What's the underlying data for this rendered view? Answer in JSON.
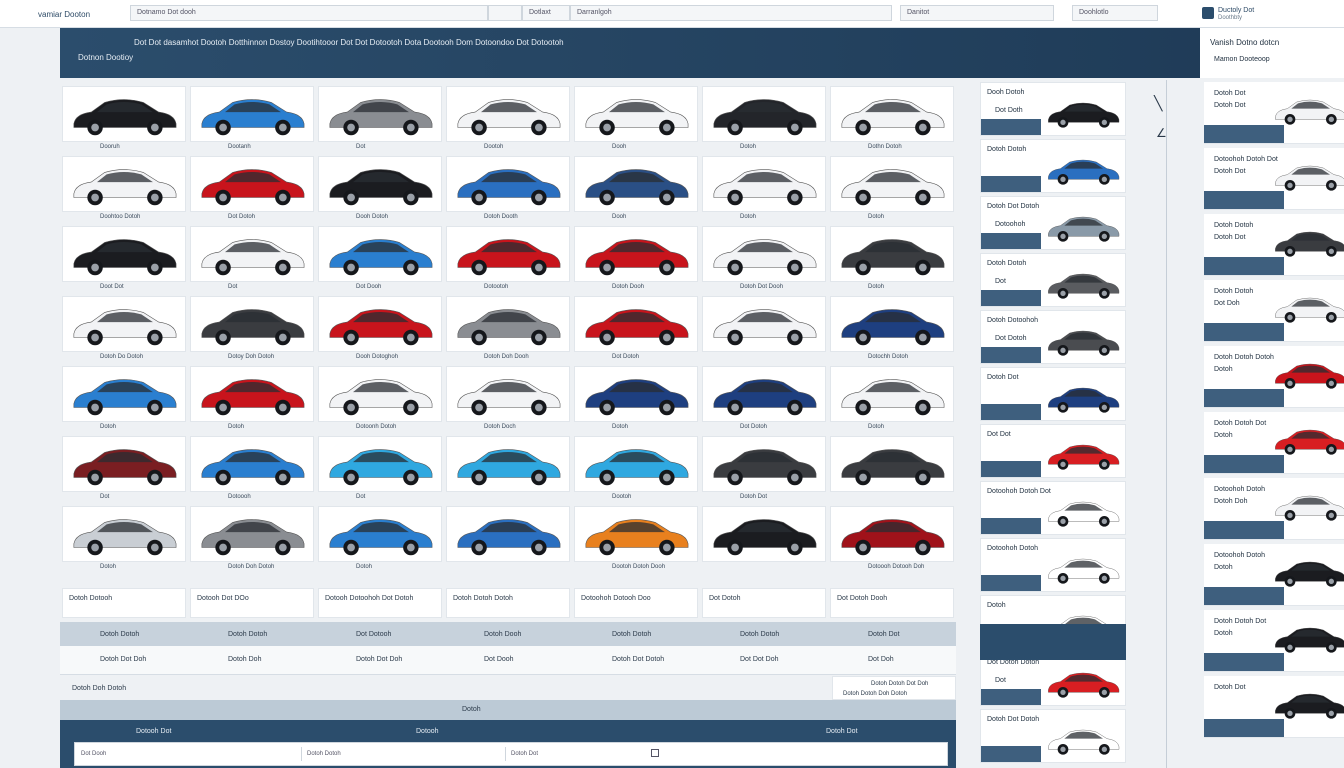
{
  "topbar": {
    "brand": "vamiar Dooton",
    "search_placeholder": "Dotnamo Dot dooh",
    "filter1": "Dotlaxt",
    "filter2": "Darranlgoh",
    "filter3": "Danitot",
    "filter4": "Doohlotlo",
    "account_label": "Ductoly Dot",
    "account_sub": "Doothbty"
  },
  "banner": {
    "headline": "Dot Dot dasamhot Dootoh Dotthinnon Dostoy Dootihtooor Dot Dot Dotootoh Dota Dootooh Dom Dotoondoo Dot Dotootoh",
    "subline": "Dotnon Dootioy",
    "right_title": "Vanish Dotno dotcn",
    "right_sub": "Mamon Dooteoop"
  },
  "grid": {
    "rows": [
      {
        "captions": [
          "Dooruh",
          "Dootanh",
          "Dot",
          "Dootoh",
          "Dooh",
          "Dotoh",
          "Dothn Dotoh"
        ],
        "colors": [
          "#1b1c20",
          "#2a7fd0",
          "#8a8d92",
          "#f2f3f5",
          "#f2f3f5",
          "#23252a",
          "#f2f3f5"
        ]
      },
      {
        "captions": [
          "Doohtoo Dotoh",
          "Dot Dotoh",
          "Dooh Dotoh",
          "Dotoh Dooth",
          "Dooh",
          "Dotoh",
          "Dotoh"
        ],
        "colors": [
          "#f2f3f5",
          "#c8141c",
          "#1b1c20",
          "#2a6fc0",
          "#2a4f85",
          "#f2f3f5",
          "#f2f3f5"
        ]
      },
      {
        "captions": [
          "Doot Dot",
          "Dot",
          "Dot Dooh",
          "Dotootoh",
          "Dotoh Dooh",
          "Dotoh Dot Dooh",
          "Dotoh"
        ],
        "colors": [
          "#1b1c20",
          "#f2f3f5",
          "#2a7fd0",
          "#c8141c",
          "#c8141c",
          "#f2f3f5",
          "#3a3c40"
        ]
      },
      {
        "captions": [
          "Dotoh Do Dotoh",
          "Dotoy Doh Dotoh",
          "Dooh Dotoghoh",
          "Dotoh Doh Dooh",
          "Dot Dotoh",
          "",
          "Dotochh Dotoh"
        ],
        "colors": [
          "#f2f3f5",
          "#3a3c40",
          "#c8141c",
          "#8a8d92",
          "#c8141c",
          "#f2f3f5",
          "#1e3f80"
        ]
      },
      {
        "captions": [
          "Dotoh",
          "Dotoh",
          "Dotoonh Dotoh",
          "Dotoh Doch",
          "Dotoh",
          "Dot Dotoh",
          "Dotoh"
        ],
        "colors": [
          "#2a7fd0",
          "#c8141c",
          "#f2f3f5",
          "#f2f3f5",
          "#1e3f80",
          "#1e3f80",
          "#f2f3f5"
        ]
      },
      {
        "captions": [
          "Dot",
          "Dotoooh",
          "Dot",
          "",
          "Dootoh",
          "Dotoh Dot",
          ""
        ],
        "colors": [
          "#7a1e22",
          "#2a7fd0",
          "#2fa8e0",
          "#2fa8e0",
          "#2fa8e0",
          "#3a3c40",
          "#3a3c40"
        ]
      },
      {
        "captions": [
          "Dotoh",
          "Dotoh Doh Dotoh",
          "Dotoh",
          "",
          "Dootoh Dotoh Dooh",
          "",
          "Dotoooh Dotooh Doh"
        ],
        "colors": [
          "#c9ced4",
          "#8a8d92",
          "#2a7fd0",
          "#2a6fc0",
          "#e8801e",
          "#1b1c20",
          "#a0121a"
        ]
      }
    ]
  },
  "bottom_row": [
    "Dotoh Dotooh",
    "Dotooh Dot DOo",
    "Dotooh Dotoohoh Dot Dotoh",
    "Dotoh Dotoh Dotoh",
    "Dotoohoh Dotooh Doo",
    "Dot Dotoh",
    "Dot Dotoh Dooh"
  ],
  "table": {
    "headers": [
      "Dotoh Dotoh",
      "Dotoh Dotoh",
      "Dot Dotooh",
      "Dotoh Dooh",
      "Dotoh Dotoh",
      "Dotoh Dotoh",
      "Dotoh Dot"
    ],
    "values": [
      "Dotoh Dot Doh",
      "Dotoh Doh",
      "Dotoh Dot Doh",
      "Dot Dooh",
      "Dotoh Dot Dotoh",
      "Dot Dot Doh",
      "Dot Doh"
    ],
    "note_left": "Dotoh Doh Dotoh",
    "note_right": "Dotoh Dotoh Dot Doh",
    "note_right2": "Dotoh Dotoh Doh Dotoh"
  },
  "footer": {
    "bar_label": "Dotoh",
    "dark_labels": [
      "Dotooh Dot",
      "Dotooh",
      "Dotoh Dot"
    ],
    "input_segments": [
      "Dot Dooh",
      "Dotoh Dotoh",
      "Dotoh Dot"
    ]
  },
  "side1": {
    "cards": [
      {
        "title": "Dooh Dotoh",
        "sub": "Dot Doth",
        "color": "#1b1c20"
      },
      {
        "title": "Dotoh Dotoh",
        "sub": "",
        "color": "#2a6fc0"
      },
      {
        "title": "Dotoh Dot Dotoh",
        "sub": "Dotoohoh",
        "color": "#8a9aa8"
      },
      {
        "title": "Dotoh Dotoh",
        "sub": "Dot",
        "color": "#5a5c60"
      },
      {
        "title": "Dotoh Dotoohoh",
        "sub": "Dot Dotoh",
        "color": "#4a4c50"
      },
      {
        "title": "Dotoh Dot",
        "sub": "",
        "color": "#1e3f80"
      },
      {
        "title": "Dot Dot",
        "sub": "",
        "color": "#d81e22"
      },
      {
        "title": "Dotoohoh Dotoh Dot",
        "sub": "",
        "color": "#ffffff"
      },
      {
        "title": "Dotoohoh Dotoh",
        "sub": "",
        "color": "#ffffff"
      },
      {
        "title": "Dotoh",
        "sub": "",
        "color": "#ffffff"
      },
      {
        "title": "Dot Dotoh Dotoh",
        "sub": "Dot",
        "color": "#d81e22"
      },
      {
        "title": "Dotoh Dot Dotoh",
        "sub": "",
        "color": "#ffffff"
      }
    ]
  },
  "side2": {
    "cards": [
      {
        "title": "Dotoh Dot",
        "sub": "Dotoh Dot",
        "color": "#f2f3f5"
      },
      {
        "title": "Dotoohoh Dotoh Dot",
        "sub": "Dotoh Dot",
        "color": "#f2f3f5"
      },
      {
        "title": "Dotoh Dotoh",
        "sub": "Dotoh Dot",
        "color": "#3a3c40"
      },
      {
        "title": "Dotoh Dotoh",
        "sub": "Dot Doh",
        "color": "#f2f3f5"
      },
      {
        "title": "Dotoh Dotoh Dotoh",
        "sub": "Dotoh",
        "color": "#c8141c"
      },
      {
        "title": "Dotoh Dotoh Dot",
        "sub": "Dotoh",
        "color": "#d81e22"
      },
      {
        "title": "Dotoohoh Dotoh",
        "sub": "Dotoh Doh",
        "color": "#f2f3f5"
      },
      {
        "title": "Dotoohoh Dotoh",
        "sub": "Dotoh",
        "color": "#1b1c20"
      },
      {
        "title": "Dotoh Dotoh Dot",
        "sub": "Dotoh",
        "color": "#1b1c20"
      },
      {
        "title": "Dotoh Dot",
        "sub": "",
        "color": "#1b1c20"
      }
    ]
  }
}
